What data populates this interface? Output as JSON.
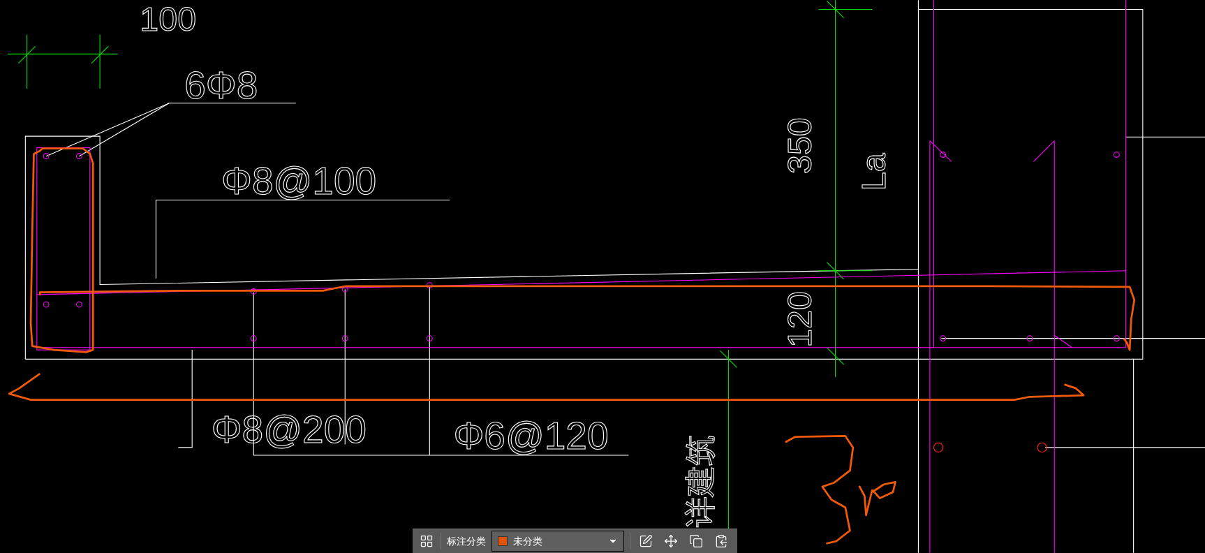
{
  "drawing": {
    "annotations": [
      {
        "text": "100"
      },
      {
        "text": "6Φ8"
      },
      {
        "text": "Φ8@100"
      },
      {
        "text": "Φ8@200"
      },
      {
        "text": "Φ6@120"
      },
      {
        "text": "350"
      },
      {
        "text": "La"
      },
      {
        "text": "120"
      },
      {
        "text": "详建筑"
      }
    ]
  },
  "toolbar": {
    "label": "标注分类",
    "category": {
      "value": "未分类",
      "color": "#e45209"
    }
  }
}
